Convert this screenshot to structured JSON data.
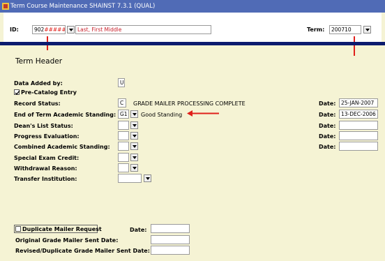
{
  "window": {
    "title": "Term Course Maintenance  SHAINST  7.3.1  (QUAL)"
  },
  "key_block": {
    "id_label": "ID:",
    "id_value": "902",
    "id_masked": "######",
    "name_value": "Last, First Middle",
    "term_label": "Term:",
    "term_value": "200710"
  },
  "term_header": {
    "title": "Term Header",
    "data_added_by_label": "Data Added by:",
    "data_added_by_value": "U",
    "pre_catalog_label": "Pre-Catalog Entry",
    "pre_catalog_checked": true,
    "record_status_label": "Record Status:",
    "record_status_value": "C",
    "record_status_desc": "GRADE MAILER PROCESSING COMPLETE",
    "eot_label": "End of Term Academic Standing:",
    "eot_value": "G1",
    "eot_desc": "Good Standing",
    "deans_list_label": "Dean's List Status:",
    "progress_label": "Progress Evaluation:",
    "combined_label": "Combined Academic Standing:",
    "special_exam_label": "Special Exam Credit:",
    "withdrawal_label": "Withdrawal Reason:",
    "transfer_label": "Transfer Institution:",
    "date_label": "Date:",
    "date1_value": "25-JAN-2007",
    "date2_value": "13-DEC-2006"
  },
  "mailer": {
    "duplicate_label": "Duplicate Mailer Request",
    "date_label": "Date:",
    "original_label": "Original Grade Mailer Sent Date:",
    "revised_label": "Revised/Duplicate Grade Mailer Sent Date:"
  },
  "colors": {
    "titlebar": "#506bb6",
    "accent_bar": "#0c1b6e",
    "annotation_arrow": "#e0201b",
    "background": "#f5f3d4"
  }
}
